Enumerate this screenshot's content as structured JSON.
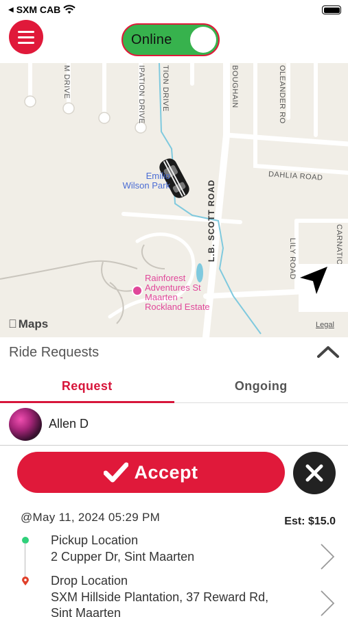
{
  "status_bar": {
    "carrier": "SXM CAB",
    "icons": [
      "back-arrow-icon",
      "wifi-icon",
      "battery-icon"
    ]
  },
  "header": {
    "menu_icon": "hamburger-menu-icon",
    "online_label": "Online",
    "online_state": true,
    "colors": {
      "brand_red": "#e0193a",
      "online_green": "#37b24d"
    }
  },
  "map": {
    "street_labels": [
      "M DRIVE",
      "IPATION DRIVE",
      "TION DRIVE",
      "BOUGHAIN",
      "OLEANDER RO",
      "DAHLIA ROAD",
      "L.B. SCOTT ROAD",
      "LILY ROAD",
      "CARNATIO"
    ],
    "park_label": "Emilio Wilson Park",
    "park_line1": "Emilio",
    "park_line2": "Wilson Park",
    "poi_line1": "Rainforest",
    "poi_line2": "Adventures St",
    "poi_line3": "Maarten -",
    "poi_line4": "Rockland Estate",
    "attribution": "Maps",
    "legal": "Legal",
    "locate_icon": "navigation-arrow-icon"
  },
  "panel": {
    "title": "Ride Requests",
    "collapse_icon": "chevron-up-icon"
  },
  "tabs": [
    {
      "label": "Request",
      "active": true
    },
    {
      "label": "Ongoing",
      "active": false
    }
  ],
  "rider": {
    "name": "Allen D"
  },
  "actions": {
    "accept_label": "Accept",
    "accept_icon": "checkmark-icon",
    "decline_icon": "close-icon"
  },
  "trip": {
    "datetime": "@May 11, 2024 05:29 PM",
    "estimate": "Est: $15.0",
    "pickup_title": "Pickup Location",
    "pickup_address": "2 Cupper Dr, Sint Maarten",
    "drop_title": "Drop Location",
    "drop_address_line1": "SXM Hillside Plantation, 37 Reward Rd,",
    "drop_address_line2": "Sint Maarten"
  }
}
